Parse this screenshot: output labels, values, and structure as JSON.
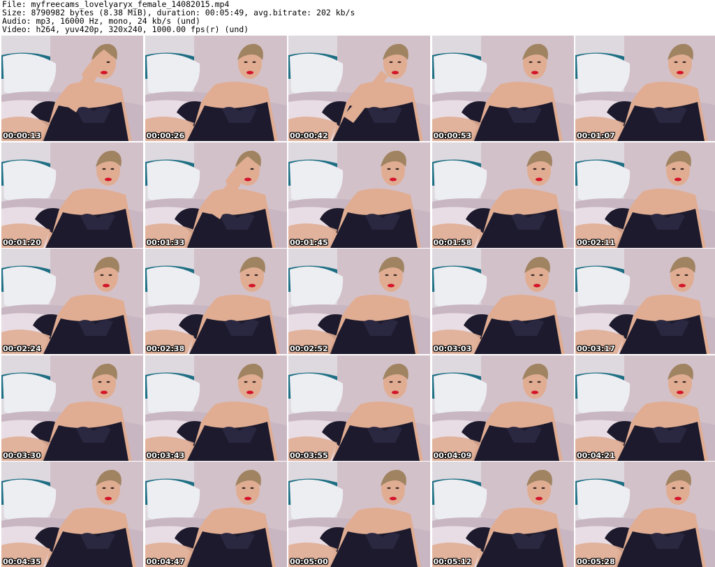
{
  "header": {
    "file_line": "File: myfreecams_lovelyaryx_female_14082015.mp4",
    "size_line": "Size: 8790982 bytes (8.38 MiB), duration: 00:05:49, avg.bitrate: 202 kb/s",
    "audio_line": "Audio: mp3, 16000 Hz, mono, 24 kb/s (und)",
    "video_line": "Video: h264, yuv420p, 320x240, 1000.00 fps(r) (und)"
  },
  "thumbnails": [
    {
      "time": "00:00:13",
      "pose": "hand-head"
    },
    {
      "time": "00:00:26",
      "pose": "normal"
    },
    {
      "time": "00:00:42",
      "pose": "hand-chin"
    },
    {
      "time": "00:00:53",
      "pose": "normal"
    },
    {
      "time": "00:01:07",
      "pose": "normal"
    },
    {
      "time": "00:01:20",
      "pose": "normal"
    },
    {
      "time": "00:01:33",
      "pose": "hand-head"
    },
    {
      "time": "00:01:45",
      "pose": "normal"
    },
    {
      "time": "00:01:58",
      "pose": "normal"
    },
    {
      "time": "00:02:11",
      "pose": "normal"
    },
    {
      "time": "00:02:24",
      "pose": "normal"
    },
    {
      "time": "00:02:38",
      "pose": "normal"
    },
    {
      "time": "00:02:52",
      "pose": "normal"
    },
    {
      "time": "00:03:03",
      "pose": "normal"
    },
    {
      "time": "00:03:17",
      "pose": "normal"
    },
    {
      "time": "00:03:30",
      "pose": "normal"
    },
    {
      "time": "00:03:43",
      "pose": "normal"
    },
    {
      "time": "00:03:55",
      "pose": "normal"
    },
    {
      "time": "00:04:09",
      "pose": "normal"
    },
    {
      "time": "00:04:21",
      "pose": "normal"
    },
    {
      "time": "00:04:35",
      "pose": "normal"
    },
    {
      "time": "00:04:47",
      "pose": "normal"
    },
    {
      "time": "00:05:00",
      "pose": "normal"
    },
    {
      "time": "00:05:12",
      "pose": "normal"
    },
    {
      "time": "00:05:28",
      "pose": "normal"
    }
  ],
  "colors": {
    "wall": "#d3c1c9",
    "pillow": "#eceef2",
    "teal": "#1f6f84",
    "bed": "#c8b6c2",
    "skin": "#e0ad93",
    "hair": "#a08462",
    "dress": "#1c1a2c",
    "lips": "#d4142a"
  }
}
